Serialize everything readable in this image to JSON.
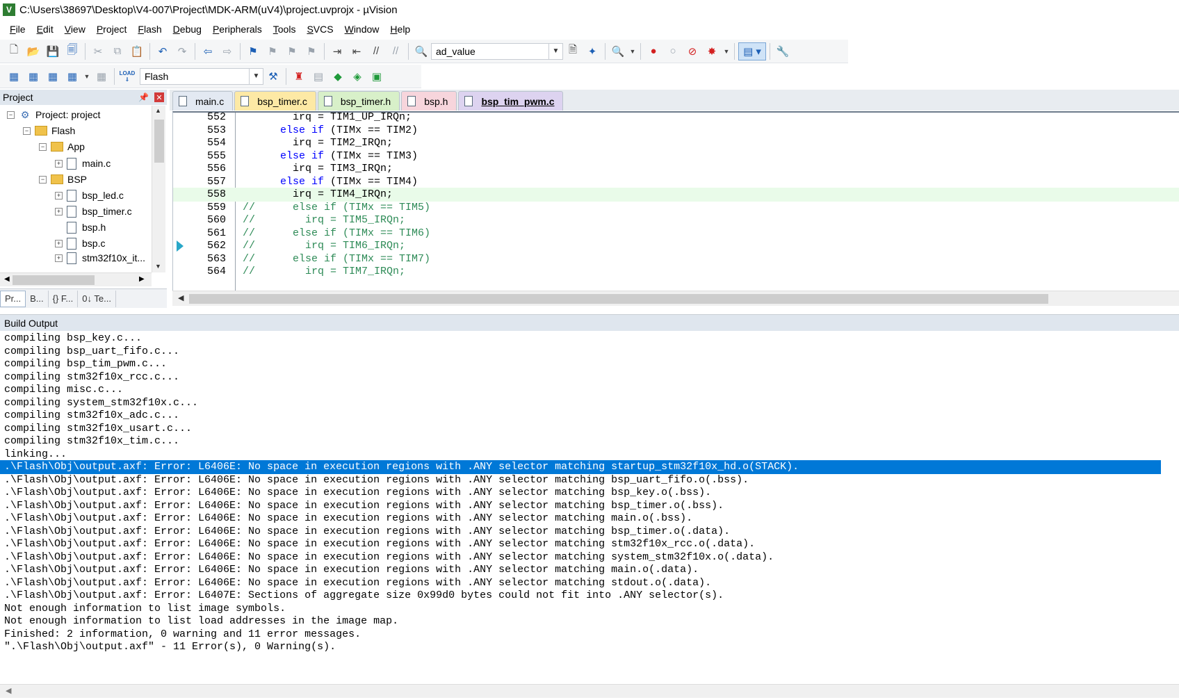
{
  "window": {
    "title": "C:\\Users\\38697\\Desktop\\V4-007\\Project\\MDK-ARM(uV4)\\project.uvprojx - µVision",
    "app_icon_letter": "V"
  },
  "menu": [
    {
      "u": "F",
      "rest": "ile"
    },
    {
      "u": "E",
      "rest": "dit"
    },
    {
      "u": "V",
      "rest": "iew"
    },
    {
      "u": "P",
      "rest": "roject"
    },
    {
      "u": "F",
      "rest": "lash"
    },
    {
      "u": "D",
      "rest": "ebug"
    },
    {
      "u": "P",
      "rest": "eripherals"
    },
    {
      "u": "T",
      "rest": "ools"
    },
    {
      "u": "S",
      "rest": "VCS"
    },
    {
      "u": "W",
      "rest": "indow"
    },
    {
      "u": "H",
      "rest": "elp"
    }
  ],
  "toolbar": {
    "find_value": "ad_value",
    "target_value": "Flash",
    "load_label": "LOAD"
  },
  "project_panel": {
    "title": "Project",
    "tree": [
      {
        "label": "Project: project",
        "level": 0,
        "kind": "project",
        "expander": "−"
      },
      {
        "label": "Flash",
        "level": 1,
        "kind": "folder",
        "expander": "−"
      },
      {
        "label": "App",
        "level": 2,
        "kind": "folder",
        "expander": "−"
      },
      {
        "label": "main.c",
        "level": 3,
        "kind": "file",
        "expander": "+"
      },
      {
        "label": "BSP",
        "level": 2,
        "kind": "folder",
        "expander": "−"
      },
      {
        "label": "bsp_led.c",
        "level": 3,
        "kind": "file",
        "expander": "+"
      },
      {
        "label": "bsp_timer.c",
        "level": 3,
        "kind": "file",
        "expander": "+"
      },
      {
        "label": "bsp.h",
        "level": 3,
        "kind": "file",
        "expander": ""
      },
      {
        "label": "bsp.c",
        "level": 3,
        "kind": "file",
        "expander": "+"
      },
      {
        "label": "stm32f10x_it...",
        "level": 3,
        "kind": "file",
        "expander": "+"
      }
    ],
    "tabs": [
      "Pr...",
      "B...",
      "{} F...",
      "0↓ Te..."
    ]
  },
  "editor": {
    "tabs": [
      {
        "label": "main.c",
        "cls": "t-main"
      },
      {
        "label": "bsp_timer.c",
        "cls": "t-timerc"
      },
      {
        "label": "bsp_timer.h",
        "cls": "t-timerh"
      },
      {
        "label": "bsp.h",
        "cls": "t-bsph"
      },
      {
        "label": "bsp_tim_pwm.c",
        "cls": "t-pwm"
      }
    ],
    "lines": [
      {
        "n": "552",
        "code": "        irq = TIM1_UP_IRQn;",
        "type": "normal"
      },
      {
        "n": "553",
        "code": "      else if (TIMx == TIM2)",
        "type": "kw"
      },
      {
        "n": "554",
        "code": "        irq = TIM2_IRQn;",
        "type": "normal"
      },
      {
        "n": "555",
        "code": "      else if (TIMx == TIM3)",
        "type": "kw"
      },
      {
        "n": "556",
        "code": "        irq = TIM3_IRQn;",
        "type": "normal"
      },
      {
        "n": "557",
        "code": "      else if (TIMx == TIM4)",
        "type": "kw"
      },
      {
        "n": "558",
        "code": "        irq = TIM4_IRQn;",
        "type": "hl"
      },
      {
        "n": "559",
        "code": "//      else if (TIMx == TIM5)",
        "type": "cmt"
      },
      {
        "n": "560",
        "code": "//        irq = TIM5_IRQn;",
        "type": "cmt"
      },
      {
        "n": "561",
        "code": "//      else if (TIMx == TIM6)",
        "type": "cmt"
      },
      {
        "n": "562",
        "code": "//        irq = TIM6_IRQn;",
        "type": "cmt",
        "arrow": true
      },
      {
        "n": "563",
        "code": "//      else if (TIMx == TIM7)",
        "type": "cmt"
      },
      {
        "n": "564",
        "code": "//        irq = TIM7_IRQn;",
        "type": "cmt"
      }
    ]
  },
  "build_output": {
    "title": "Build Output",
    "lines": [
      {
        "text": "compiling bsp_key.c..."
      },
      {
        "text": "compiling bsp_uart_fifo.c..."
      },
      {
        "text": "compiling bsp_tim_pwm.c..."
      },
      {
        "text": "compiling stm32f10x_rcc.c..."
      },
      {
        "text": "compiling misc.c..."
      },
      {
        "text": "compiling system_stm32f10x.c..."
      },
      {
        "text": "compiling stm32f10x_adc.c..."
      },
      {
        "text": "compiling stm32f10x_usart.c..."
      },
      {
        "text": "compiling stm32f10x_tim.c..."
      },
      {
        "text": "linking..."
      },
      {
        "text": ".\\Flash\\Obj\\output.axf: Error: L6406E: No space in execution regions with .ANY selector matching startup_stm32f10x_hd.o(STACK).",
        "selected": true
      },
      {
        "text": ".\\Flash\\Obj\\output.axf: Error: L6406E: No space in execution regions with .ANY selector matching bsp_uart_fifo.o(.bss)."
      },
      {
        "text": ".\\Flash\\Obj\\output.axf: Error: L6406E: No space in execution regions with .ANY selector matching bsp_key.o(.bss)."
      },
      {
        "text": ".\\Flash\\Obj\\output.axf: Error: L6406E: No space in execution regions with .ANY selector matching bsp_timer.o(.bss)."
      },
      {
        "text": ".\\Flash\\Obj\\output.axf: Error: L6406E: No space in execution regions with .ANY selector matching main.o(.bss)."
      },
      {
        "text": ".\\Flash\\Obj\\output.axf: Error: L6406E: No space in execution regions with .ANY selector matching bsp_timer.o(.data)."
      },
      {
        "text": ".\\Flash\\Obj\\output.axf: Error: L6406E: No space in execution regions with .ANY selector matching stm32f10x_rcc.o(.data)."
      },
      {
        "text": ".\\Flash\\Obj\\output.axf: Error: L6406E: No space in execution regions with .ANY selector matching system_stm32f10x.o(.data)."
      },
      {
        "text": ".\\Flash\\Obj\\output.axf: Error: L6406E: No space in execution regions with .ANY selector matching main.o(.data)."
      },
      {
        "text": ".\\Flash\\Obj\\output.axf: Error: L6406E: No space in execution regions with .ANY selector matching stdout.o(.data)."
      },
      {
        "text": ".\\Flash\\Obj\\output.axf: Error: L6407E: Sections of aggregate size 0x99d0 bytes could not fit into .ANY selector(s)."
      },
      {
        "text": "Not enough information to list image symbols."
      },
      {
        "text": "Not enough information to list load addresses in the image map."
      },
      {
        "text": "Finished: 2 information, 0 warning and 11 error messages."
      },
      {
        "text": "\".\\Flash\\Obj\\output.axf\" - 11 Error(s), 0 Warning(s)."
      }
    ]
  },
  "colors": {
    "selection": "#0078d7",
    "keyword": "#0000ff",
    "comment": "#2e8b57",
    "current_line": "#e9fbe9"
  }
}
